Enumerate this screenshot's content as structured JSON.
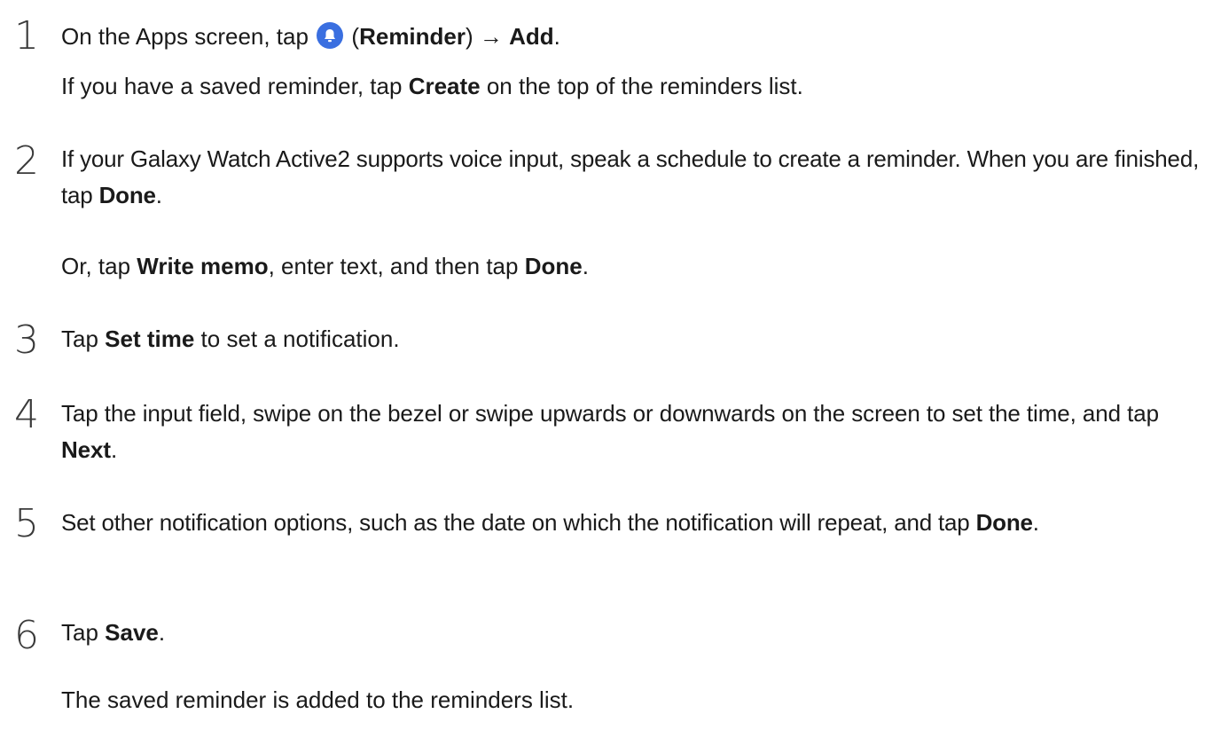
{
  "steps": [
    {
      "number": "1",
      "line1": {
        "t1": "On the Apps screen, tap ",
        "icon": "reminder-bell-icon",
        "t2": " (",
        "b1": "Reminder",
        "t3": ") → ",
        "b2": "Add",
        "t4": "."
      },
      "line2": {
        "t1": "If you have a saved reminder, tap ",
        "b1": "Create",
        "t2": " on the top of the reminders list."
      }
    },
    {
      "number": "2",
      "line1": {
        "t1": "If your Galaxy Watch Active2 supports voice input, speak a schedule to create a reminder. When you are finished, tap ",
        "b1": "Done",
        "t2": "."
      },
      "line2": {
        "t1": "Or, tap ",
        "b1": "Write memo",
        "t2": ", enter text, and then tap ",
        "b2": "Done",
        "t3": "."
      }
    },
    {
      "number": "3",
      "line1": {
        "t1": "Tap ",
        "b1": "Set time",
        "t2": " to set a notification."
      }
    },
    {
      "number": "4",
      "line1": {
        "t1": "Tap the input field, swipe on the bezel or swipe upwards or downwards on the screen to set the time, and tap ",
        "b1": "Next",
        "t2": "."
      }
    },
    {
      "number": "5",
      "line1": {
        "t1": "Set other notification options, such as the date on which the notification will repeat, and tap ",
        "b1": "Done",
        "t2": "."
      }
    },
    {
      "number": "6",
      "line1": {
        "t1": "Tap ",
        "b1": "Save",
        "t2": "."
      },
      "line2": {
        "t1": "The saved reminder is added to the reminders list."
      }
    }
  ],
  "colors": {
    "text": "#1a1a1a",
    "step_number": "#3a3a3a",
    "icon_blue": "#3a6fe0"
  }
}
